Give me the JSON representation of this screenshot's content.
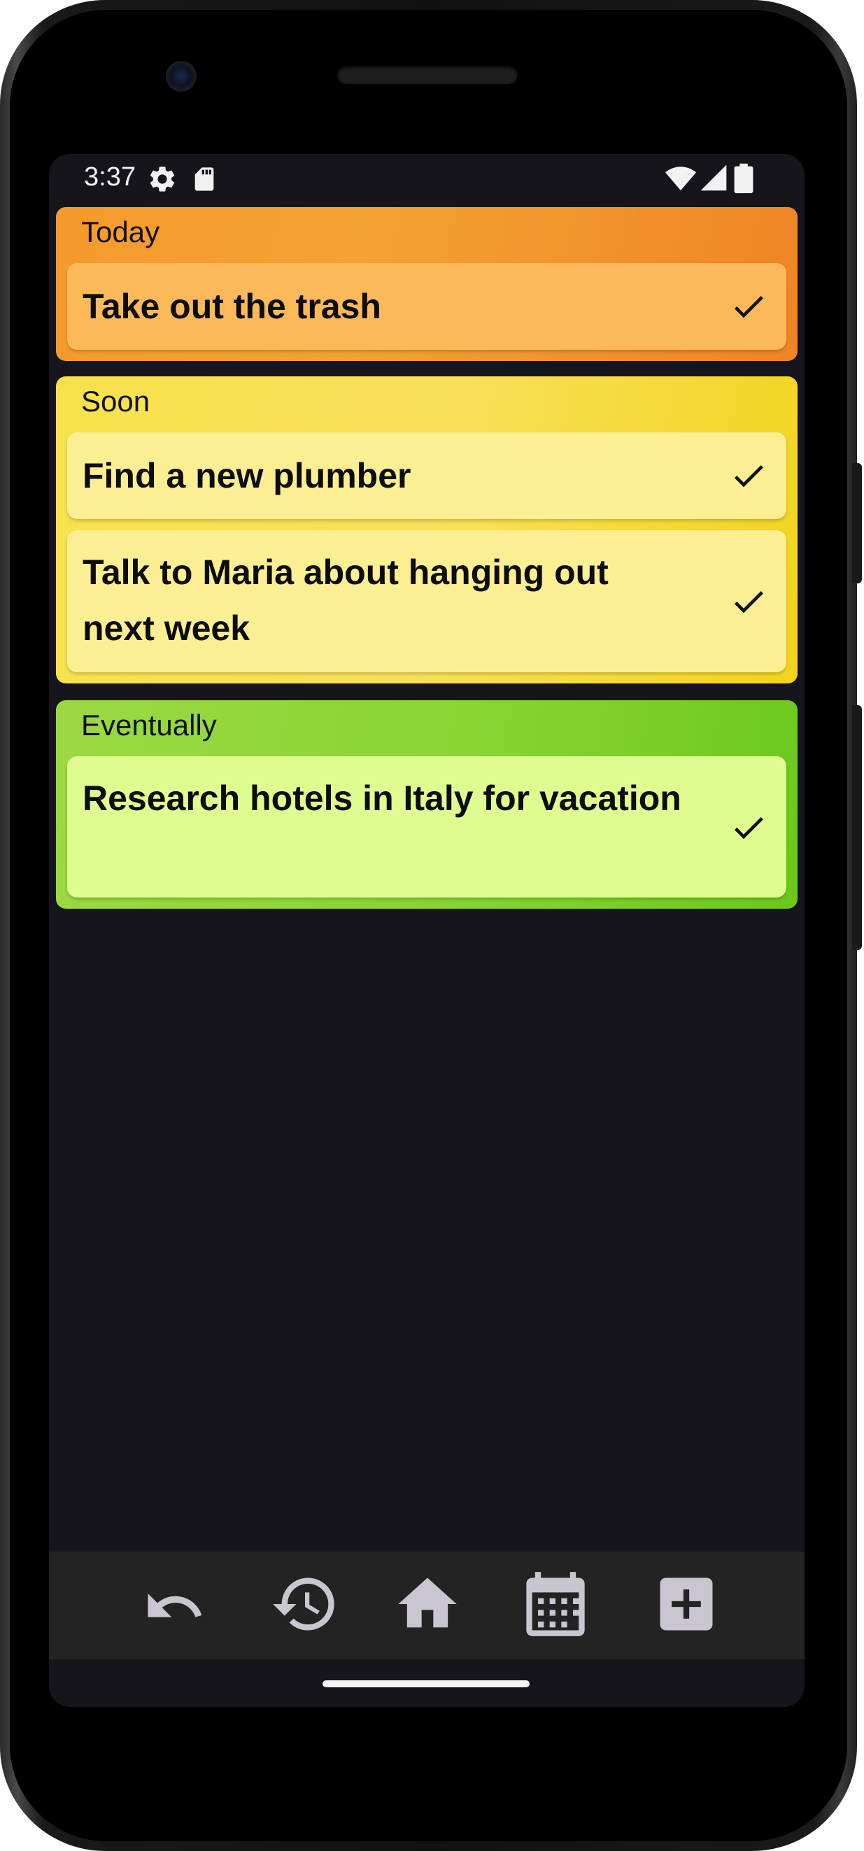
{
  "status_bar": {
    "time": "3:37",
    "left_icons": [
      "settings-gear-icon",
      "sd-card-icon"
    ],
    "right_icons": [
      "wifi-icon",
      "cell-signal-icon",
      "battery-icon"
    ]
  },
  "sections": [
    {
      "title": "Today",
      "color": "#f59a2c",
      "tasks": [
        {
          "text": "Take out the trash"
        }
      ]
    },
    {
      "title": "Soon",
      "color": "#f7e24c",
      "tasks": [
        {
          "text": "Find a new plumber"
        },
        {
          "text": "Talk to Maria about hanging out next week"
        }
      ]
    },
    {
      "title": "Eventually",
      "color": "#8ad634",
      "tasks": [
        {
          "text": "Research hotels in Italy for vacation"
        }
      ]
    }
  ],
  "bottom_nav": {
    "items": [
      "undo-icon",
      "history-icon",
      "home-icon",
      "calendar-icon",
      "add-icon"
    ],
    "icon_color": "#c9c6d2"
  }
}
